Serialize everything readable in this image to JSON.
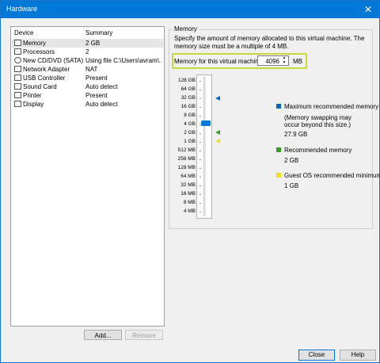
{
  "window": {
    "title": "Hardware",
    "close_glyph": "✕"
  },
  "devices": {
    "col_device": "Device",
    "col_summary": "Summary",
    "rows": [
      {
        "name": "Memory",
        "summary": "2 GB",
        "icon": "memory-icon"
      },
      {
        "name": "Processors",
        "summary": "2",
        "icon": "processor-icon"
      },
      {
        "name": "New CD/DVD (SATA)",
        "summary": "Using file C:\\Users\\avram\\...",
        "icon": "cd-dvd-icon"
      },
      {
        "name": "Network Adapter",
        "summary": "NAT",
        "icon": "network-adapter-icon"
      },
      {
        "name": "USB Controller",
        "summary": "Present",
        "icon": "usb-icon"
      },
      {
        "name": "Sound Card",
        "summary": "Auto detect",
        "icon": "sound-card-icon"
      },
      {
        "name": "Printer",
        "summary": "Present",
        "icon": "printer-icon"
      },
      {
        "name": "Display",
        "summary": "Auto detect",
        "icon": "display-icon"
      }
    ],
    "add_label": "Add...",
    "remove_label": "Remove"
  },
  "memory": {
    "group_label": "Memory",
    "description": "Specify the amount of memory allocated to this virtual machine. The memory size must be a multiple of 4 MB.",
    "field_label": "Memory for this virtual machine:",
    "value": "4096",
    "unit": "MB",
    "scale_labels": [
      "128 GB",
      "64 GB",
      "32 GB",
      "16 GB",
      "8 GB",
      "4 GB",
      "2 GB",
      "1 GB",
      "512 MB",
      "256 MB",
      "128 MB",
      "64 MB",
      "32 MB",
      "16 MB",
      "8 MB",
      "4 MB"
    ],
    "legend": {
      "max_title": "Maximum recommended memory",
      "max_note_1": "(Memory swapping may",
      "max_note_2": "occur beyond this size.)",
      "max_value": "27.9 GB",
      "rec_title": "Recommended memory",
      "rec_value": "2 GB",
      "min_title": "Guest OS recommended minimum",
      "min_value": "1 GB"
    },
    "colors": {
      "max": "#0a64b8",
      "recommended": "#3a9a2a",
      "minimum": "#f2df1d",
      "highlight": "#c7d93a"
    }
  },
  "footer": {
    "close_label": "Close",
    "help_label": "Help"
  }
}
